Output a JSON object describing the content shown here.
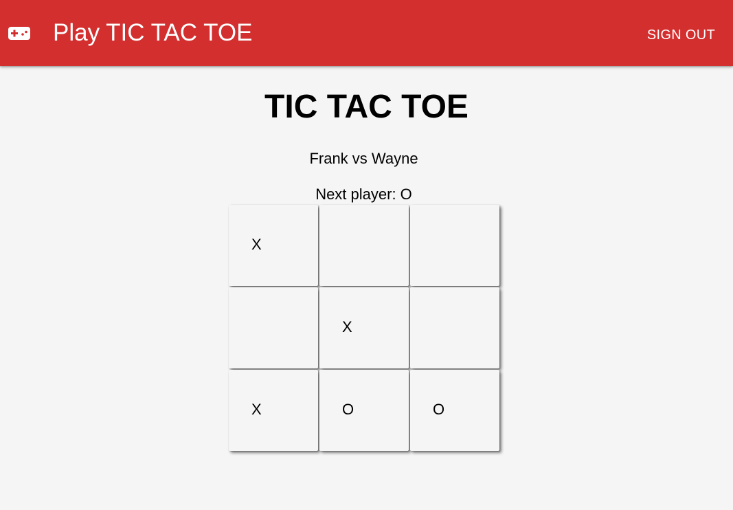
{
  "header": {
    "logo_icon": "gamepad-icon",
    "title": "Play TIC TAC TOE",
    "sign_out_label": "SIGN OUT",
    "brand_color": "#d32f2f"
  },
  "game": {
    "title": "TIC TAC TOE",
    "matchup": "Frank vs Wayne",
    "status": "Next player: O",
    "board": [
      [
        "X",
        "",
        ""
      ],
      [
        "",
        "X",
        ""
      ],
      [
        "X",
        "O",
        "O"
      ]
    ]
  }
}
